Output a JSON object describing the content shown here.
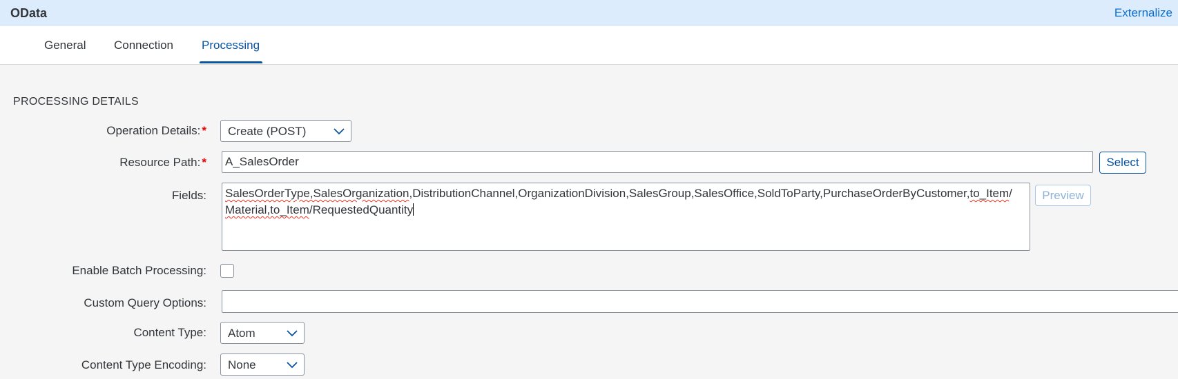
{
  "app": {
    "title": "OData",
    "externalize_label": "Externalize"
  },
  "tabs": [
    {
      "label": "General",
      "active": false
    },
    {
      "label": "Connection",
      "active": false
    },
    {
      "label": "Processing",
      "active": true
    }
  ],
  "section": {
    "title": "PROCESSING DETAILS"
  },
  "form": {
    "operation": {
      "label": "Operation Details:",
      "required_mark": "*",
      "value": "Create (POST)"
    },
    "resource_path": {
      "label": "Resource Path:",
      "required_mark": "*",
      "value": "A_SalesOrder",
      "select_label": "Select"
    },
    "fields": {
      "label": "Fields:",
      "value_part1": "SalesOrderType,SalesOrganization",
      "value_part2": ",DistributionChannel,OrganizationDivision,SalesGroup,SalesOffice,SoldToParty,PurchaseOrderByCustomer,",
      "value_part3": "to_Item",
      "value_part4": "/",
      "value_part5": "Material,to_Item",
      "value_part6": "/RequestedQuantity",
      "preview_label": "Preview"
    },
    "batch": {
      "label": "Enable Batch Processing:",
      "checked": false
    },
    "custom_query": {
      "label": "Custom Query Options:",
      "value": ""
    },
    "content_type": {
      "label": "Content Type:",
      "value": "Atom"
    },
    "encoding": {
      "label": "Content Type Encoding:",
      "value": "None"
    }
  },
  "colors": {
    "accent": "#0854a0",
    "header_bg": "#dcecfc",
    "required": "#ee0000"
  },
  "icons": {
    "dropdown": "chevron-down-icon"
  }
}
